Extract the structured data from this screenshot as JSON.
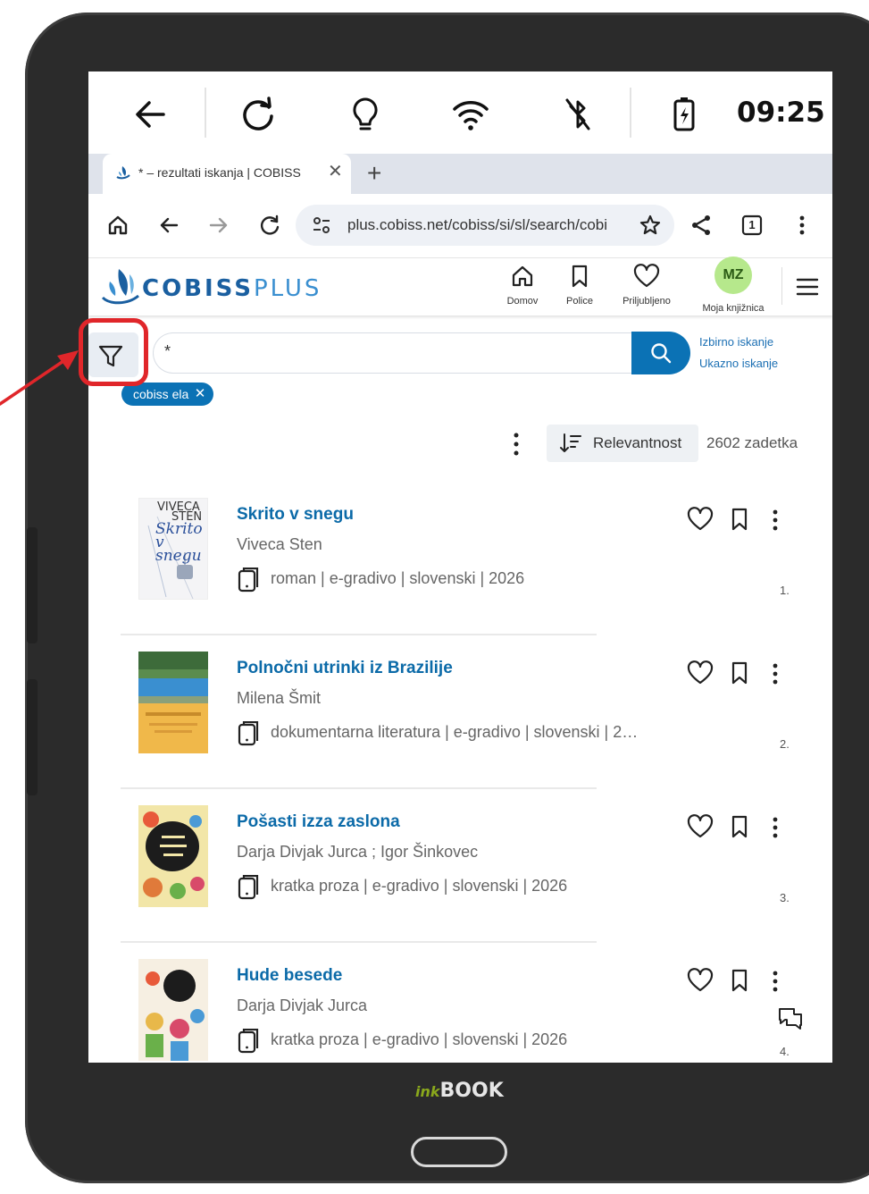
{
  "status_bar": {
    "time": "09:25",
    "icons": [
      "back-icon",
      "refresh-icon",
      "frontlight-bulb-icon",
      "wifi-icon",
      "bluetooth-off-icon",
      "battery-charging-icon"
    ]
  },
  "browser": {
    "tab_title": "* – rezultati iskanja | COBISS",
    "tab_close": "✕",
    "new_tab": "+",
    "url": "plus.cobiss.net/cobiss/si/sl/search/cobi",
    "tab_count": "1"
  },
  "site": {
    "logo_bold": "COBISS",
    "logo_light": "PLUS",
    "nav": [
      {
        "label": "Domov",
        "icon": "home-icon"
      },
      {
        "label": "Police",
        "icon": "bookmark-icon"
      },
      {
        "label": "Priljubljeno",
        "icon": "heart-icon"
      },
      {
        "label": "Moja knjižnica",
        "avatar": "MZ"
      }
    ]
  },
  "search": {
    "query": "*",
    "advanced_links": [
      "Izbirno iskanje",
      "Ukazno iskanje"
    ],
    "filter_chip": "cobiss ela",
    "chip_close": "✕"
  },
  "sort": {
    "label": "Relevantnost",
    "hits": "2602 zadetka"
  },
  "results": [
    {
      "title": "Skrito v snegu",
      "author": "Viveca Sten",
      "meta": "roman | e-gradivo | slovenski | 2026",
      "num": "1."
    },
    {
      "title": "Polnočni utrinki iz Brazilije",
      "author": "Milena Šmit",
      "meta": "dokumentarna literatura | e-gradivo | slovenski | 2…",
      "num": "2."
    },
    {
      "title": "Pošasti izza zaslona",
      "author": "Darja Divjak Jurca ; Igor Šinkovec",
      "meta": "kratka proza | e-gradivo | slovenski | 2026",
      "num": "3."
    },
    {
      "title": "Hude besede",
      "author": "Darja Divjak Jurca",
      "meta": "kratka proza | e-gradivo | slovenski | 2026",
      "num": "4."
    }
  ],
  "cover_text": {
    "r1_lines": [
      "VIVECA",
      "STEN",
      "Skrito",
      "v snegu"
    ]
  },
  "device": {
    "brand_ink": "ink",
    "brand_book": "BOOK"
  },
  "colors": {
    "accent": "#0b72b5",
    "title_link": "#0b6aa8",
    "highlight": "#e0262a",
    "avatar": "#b6e88c"
  }
}
